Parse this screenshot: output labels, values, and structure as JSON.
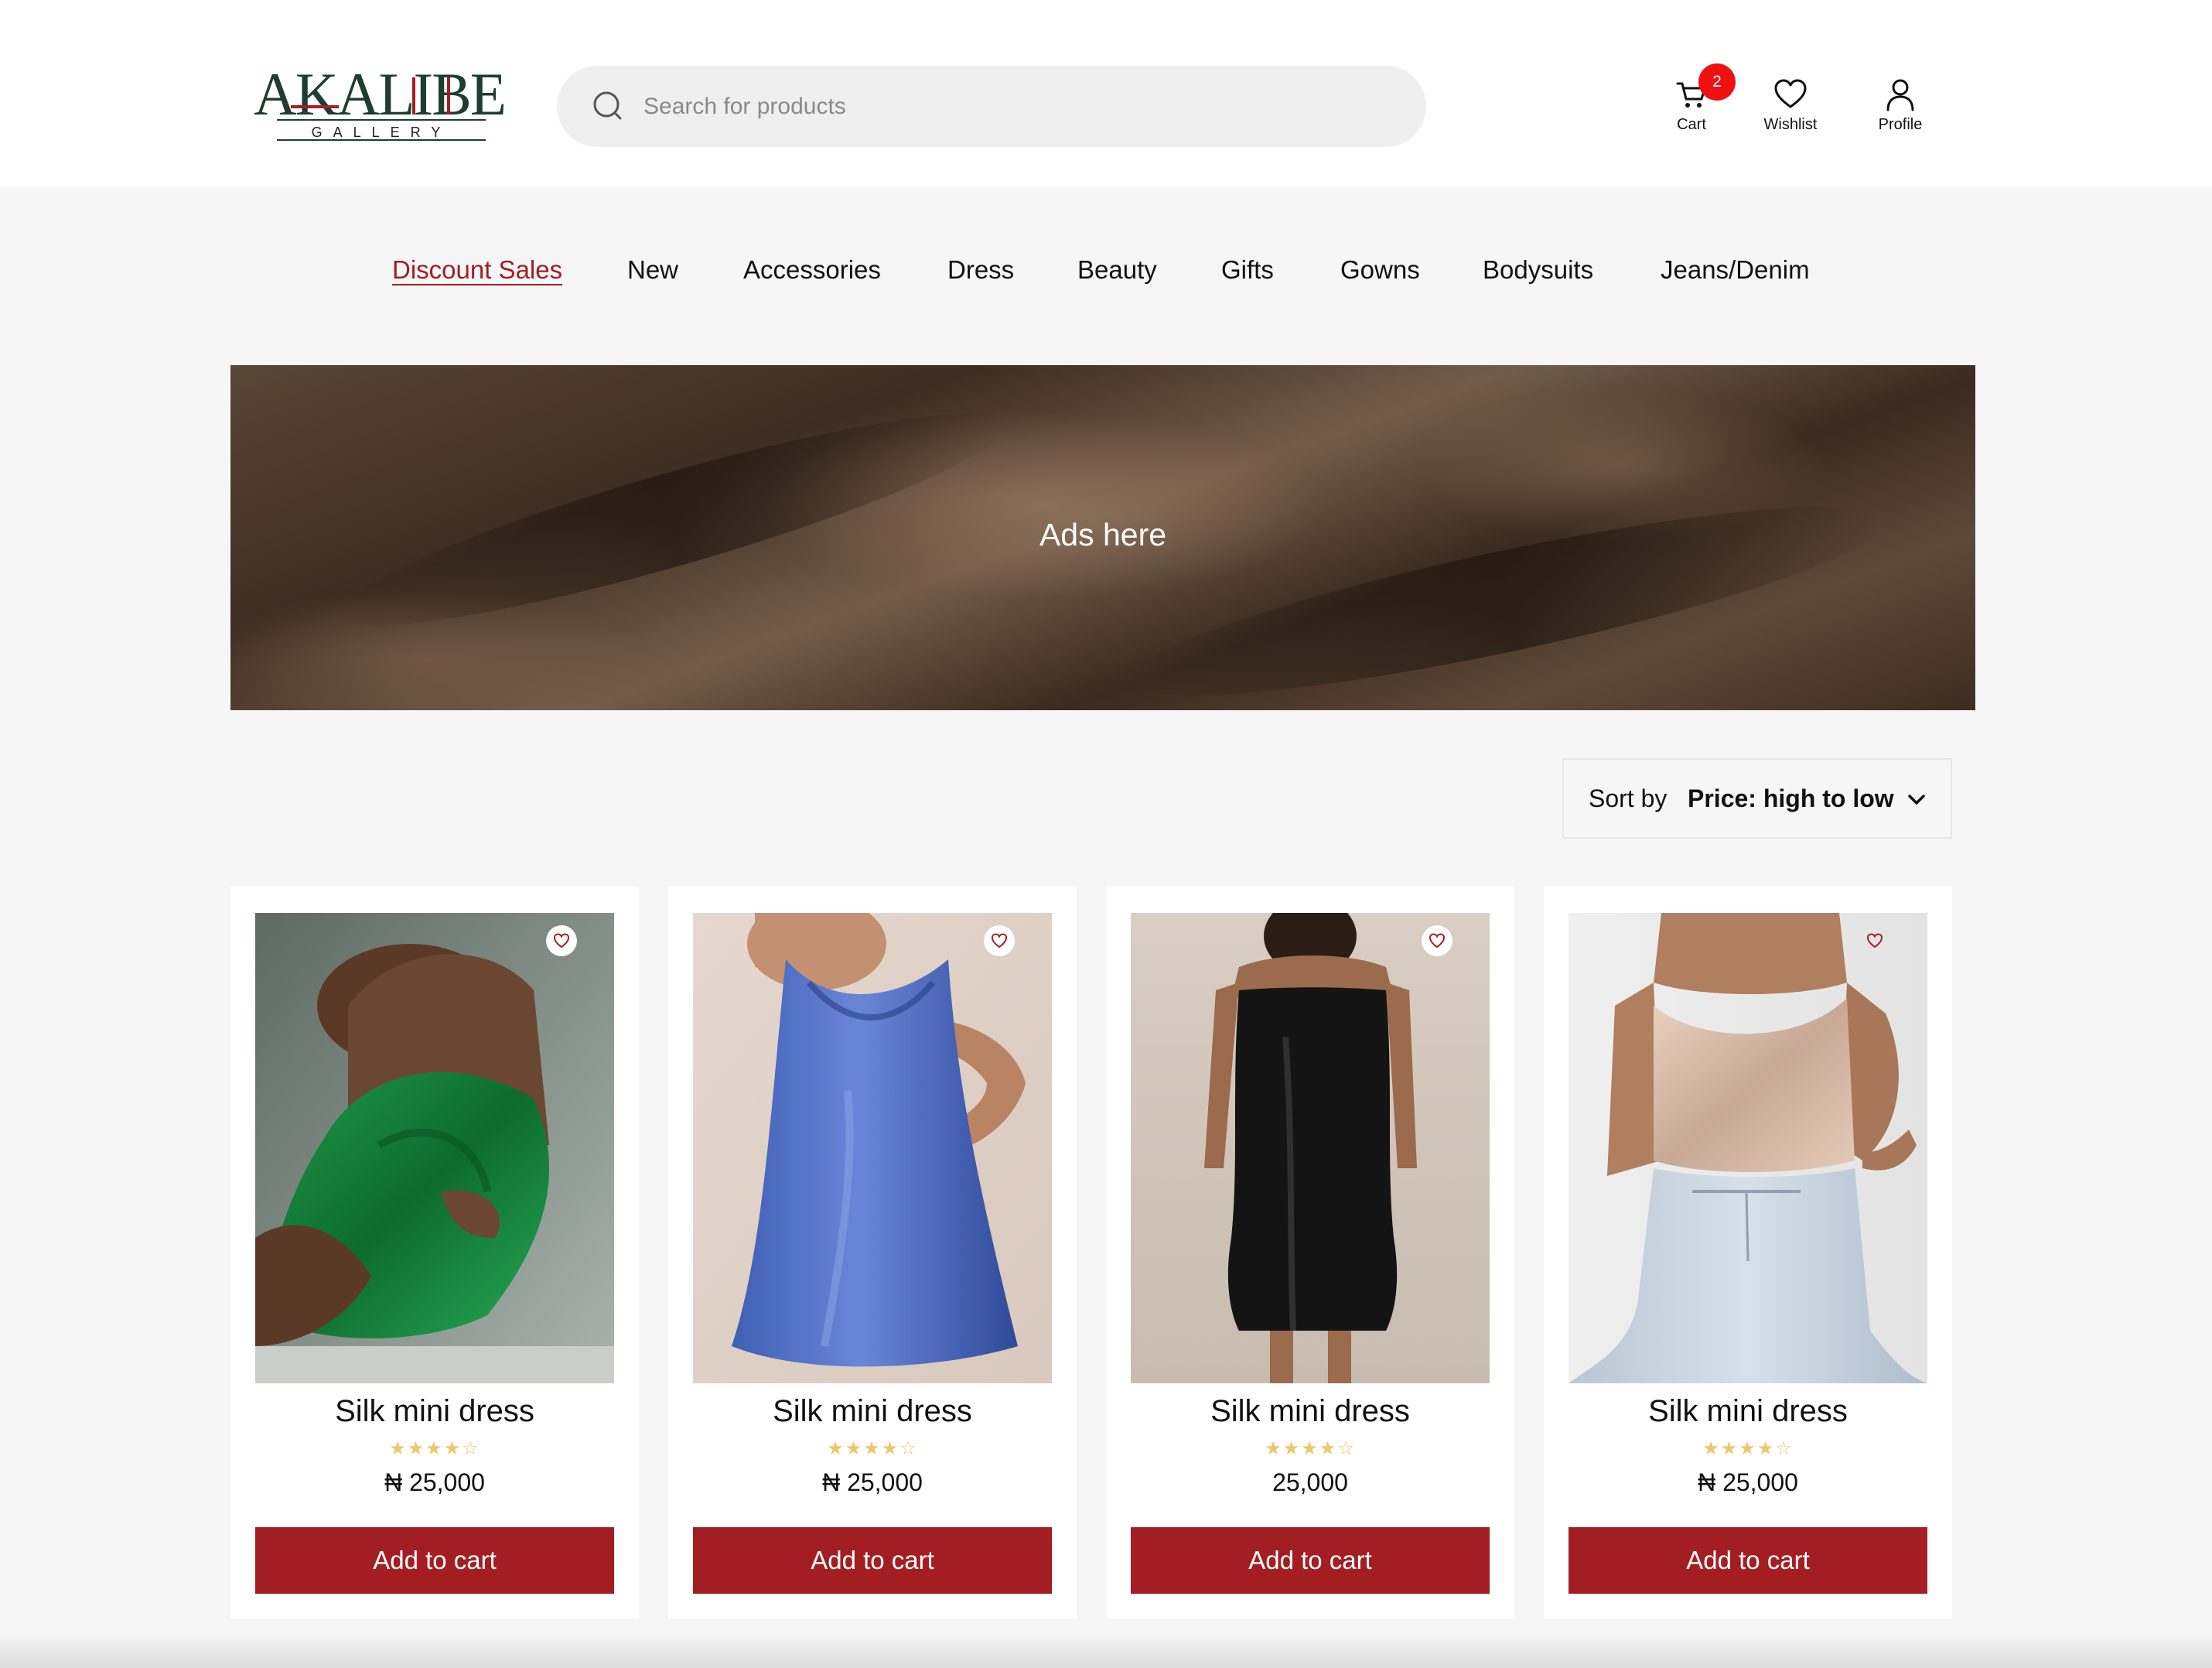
{
  "header": {
    "logo": {
      "main": "AKALIBE",
      "sub": "G A L L E R Y"
    },
    "search": {
      "placeholder": "Search for products",
      "value": ""
    },
    "actions": {
      "cart": {
        "label": "Cart",
        "badge": "2"
      },
      "wishlist": {
        "label": "Wishlist"
      },
      "profile": {
        "label": "Profile"
      }
    }
  },
  "nav": {
    "items": [
      {
        "label": "Discount Sales",
        "active": true
      },
      {
        "label": "New"
      },
      {
        "label": "Accessories"
      },
      {
        "label": "Dress"
      },
      {
        "label": "Beauty"
      },
      {
        "label": "Gifts"
      },
      {
        "label": "Gowns"
      },
      {
        "label": "Bodysuits"
      },
      {
        "label": "Jeans/Denim"
      }
    ]
  },
  "banner": {
    "text": "Ads here"
  },
  "sort": {
    "prefix": "Sort by",
    "value": "Price: high to low"
  },
  "products": [
    {
      "title": "Silk mini dress",
      "rating": 4,
      "stars": "★★★★☆",
      "price": "₦ 25,000",
      "cta": "Add to cart",
      "image": "green-silk-dress"
    },
    {
      "title": "Silk mini dress",
      "rating": 4,
      "stars": "★★★★☆",
      "price": "₦ 25,000",
      "cta": "Add to cart",
      "image": "blue-silk-dress"
    },
    {
      "title": "Silk mini dress",
      "rating": 4,
      "stars": "★★★★☆",
      "price": "25,000",
      "cta": "Add to cart",
      "image": "black-silk-dress"
    },
    {
      "title": "Silk mini dress",
      "rating": 4,
      "stars": "★★★★☆",
      "price": "₦ 25,000",
      "cta": "Add to cart",
      "image": "champagne-silk-top-jeans"
    }
  ],
  "colors": {
    "accent": "#a31e22",
    "badge": "#ee1111",
    "star": "#f0c56c",
    "background": "#f6f6f6"
  }
}
